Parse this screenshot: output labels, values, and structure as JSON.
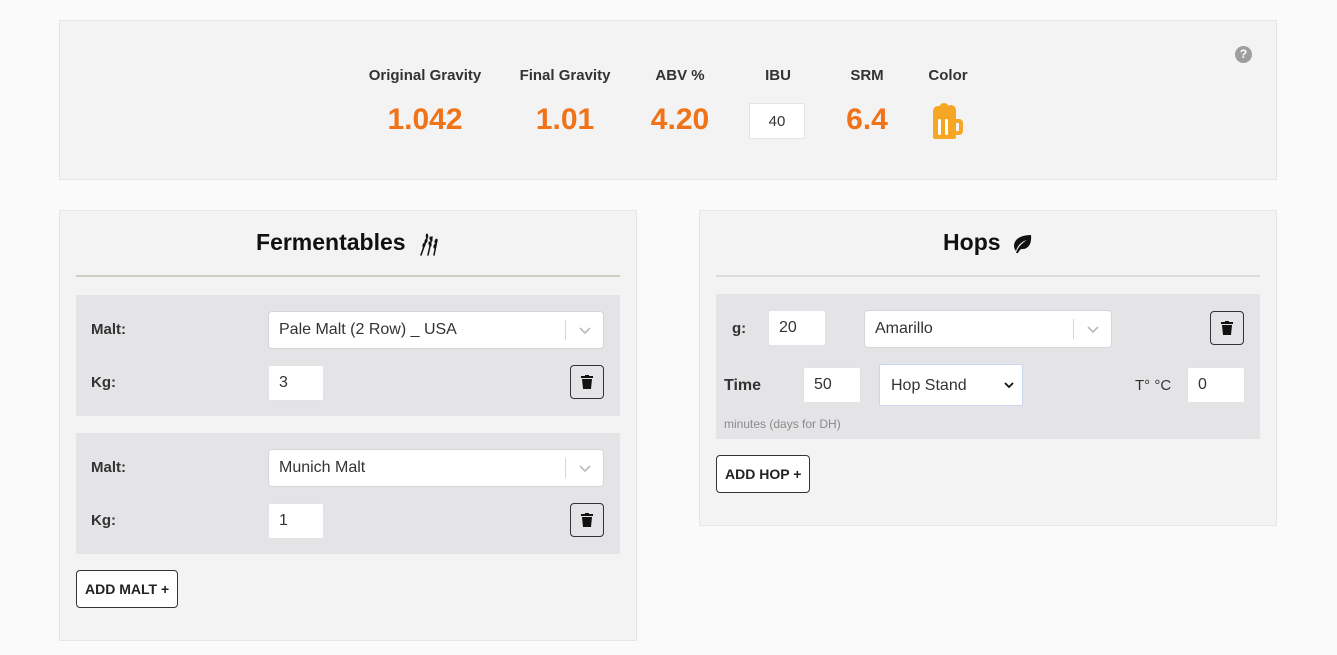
{
  "stats": {
    "og": {
      "label": "Original Gravity",
      "value": "1.042"
    },
    "fg": {
      "label": "Final Gravity",
      "value": "1.01"
    },
    "abv": {
      "label": "ABV %",
      "value": "4.20"
    },
    "ibu": {
      "label": "IBU",
      "value": "40"
    },
    "srm": {
      "label": "SRM",
      "value": "6.4"
    },
    "color": {
      "label": "Color",
      "icon": "beer-mug-icon",
      "swatch": "#f5a623"
    }
  },
  "help": {
    "icon": "question-circle-icon",
    "glyph": "?"
  },
  "fermentables": {
    "title": "Fermentables",
    "title_icon": "wheat-icon",
    "items": [
      {
        "malt_label": "Malt:",
        "malt": "Pale Malt (2 Row) _ USA",
        "kg_label": "Kg:",
        "kg": "3"
      },
      {
        "malt_label": "Malt:",
        "malt": "Munich Malt",
        "kg_label": "Kg:",
        "kg": "1"
      }
    ],
    "add_button": "ADD MALT +"
  },
  "hops": {
    "title": "Hops",
    "title_icon": "leaf-icon",
    "items": [
      {
        "g_label": "g:",
        "g": "20",
        "variety": "Amarillo",
        "time_label": "Time",
        "time": "50",
        "use": "Hop Stand",
        "temp_label": "T° °C",
        "temp": "0",
        "hint": "minutes (days for DH)"
      }
    ],
    "add_button": "ADD HOP +"
  },
  "colors": {
    "accent": "#f07318",
    "panel": "#f3f3f3",
    "card": "#e4e4e6"
  }
}
